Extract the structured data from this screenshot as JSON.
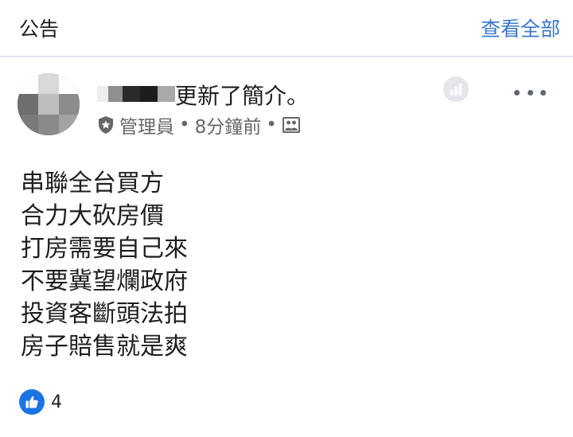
{
  "header": {
    "title": "公告",
    "see_all": "查看全部"
  },
  "post": {
    "activity": "更新了簡介。",
    "meta": {
      "role": "管理員",
      "dot": "•",
      "time": "8分鐘前"
    },
    "icons": {
      "admin_badge": "shield-icon",
      "privacy": "group-photo-icon",
      "insights": "bar-chart-icon",
      "more": "more-icon"
    },
    "lines": [
      "串聯全台買方",
      "合力大砍房價",
      "打房需要自己來",
      "不要冀望爛政府",
      "投資客斷頭法拍",
      "房子賠售就是爽"
    ],
    "reactions": {
      "type": "like",
      "count": "4"
    }
  },
  "colors": {
    "link": "#3a78c9",
    "meta": "#65676b",
    "like": "#1b74e4",
    "divider": "#dfe3ea"
  }
}
